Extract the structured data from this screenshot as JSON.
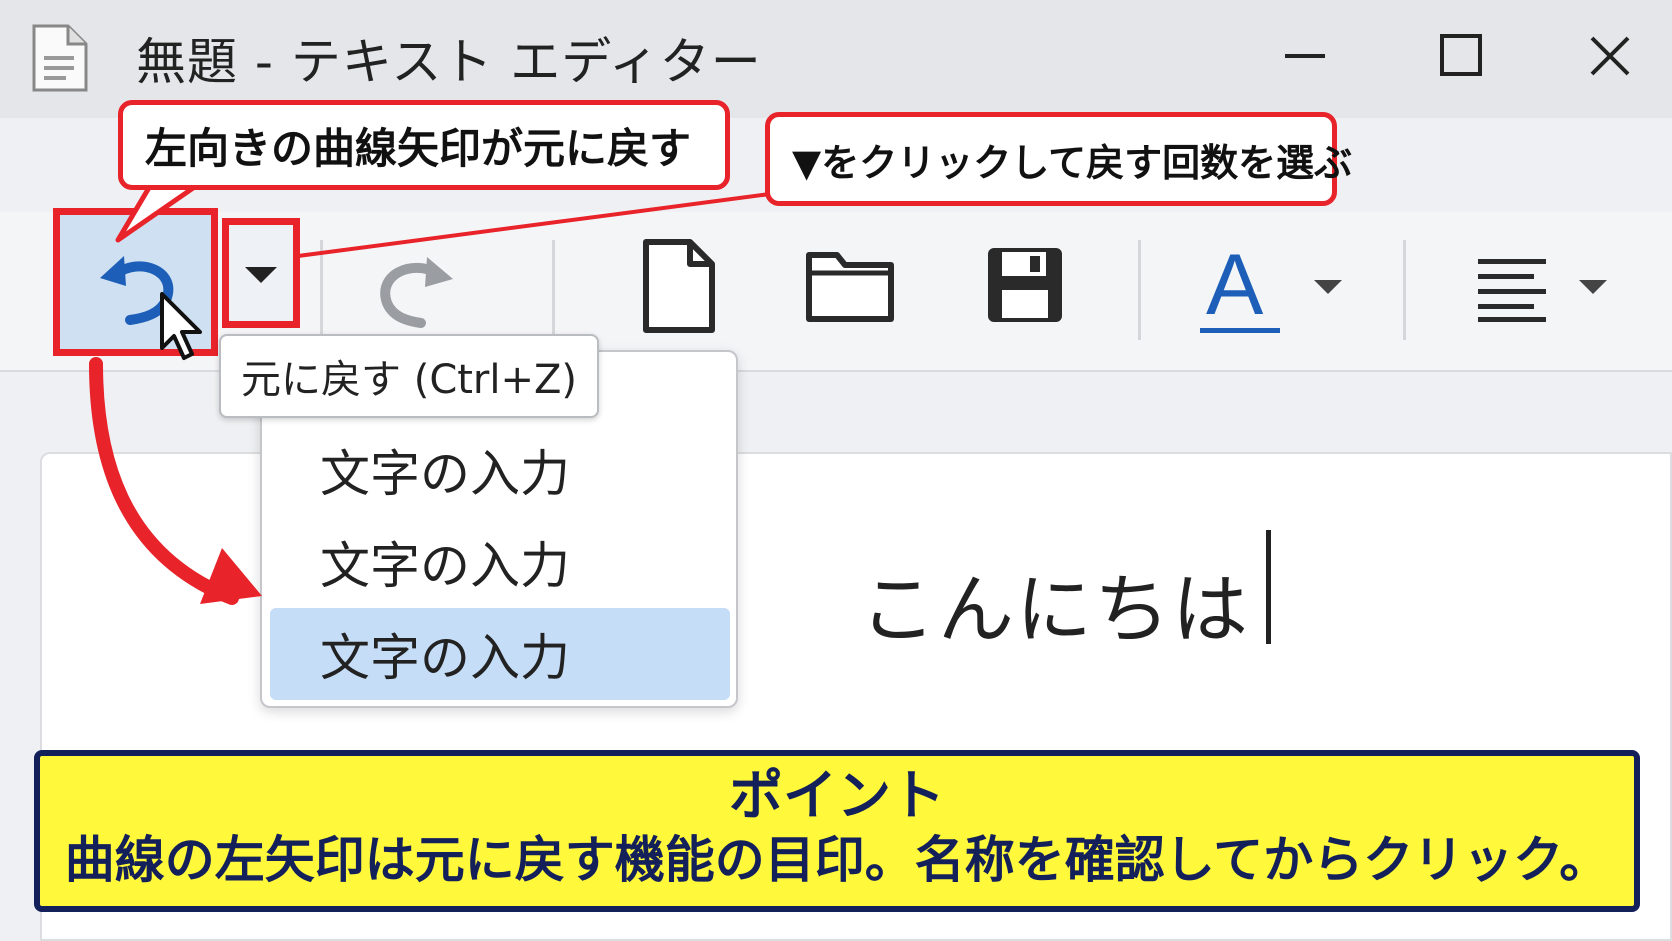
{
  "window": {
    "title": "無題 - テキスト エディター",
    "app_icon": "document-icon",
    "controls": [
      "minimize-icon",
      "maximize-icon",
      "close-icon"
    ]
  },
  "toolbar": {
    "buttons": [
      {
        "name": "undo",
        "icon": "undo-arrow-icon"
      },
      {
        "name": "undo-dropdown",
        "icon": "chevron-down-icon"
      },
      {
        "name": "redo",
        "icon": "redo-arrow-icon"
      },
      {
        "name": "new",
        "icon": "new-document-icon"
      },
      {
        "name": "open",
        "icon": "folder-icon"
      },
      {
        "name": "save",
        "icon": "save-disk-icon"
      },
      {
        "name": "font-color",
        "icon": "font-color-icon",
        "label": "A"
      },
      {
        "name": "align",
        "icon": "align-lines-icon"
      }
    ],
    "font_color_label": "A"
  },
  "tooltip": {
    "text": "元に戻す (Ctrl+Z)"
  },
  "undo_history": {
    "items": [
      "文字の入力",
      "文字の入力",
      "文字の入力"
    ],
    "selected_index": 2
  },
  "document": {
    "text": "こんにちは"
  },
  "callouts": {
    "undo": "左向きの曲線矢印が元に戻す",
    "dropdown": "▼をクリックして戻す回数を選ぶ"
  },
  "point": {
    "title": "ポイント",
    "body": "曲線の左矢印は元に戻す機能の目印。名称を確認してからクリック。"
  },
  "colors": {
    "highlight_red": "#e8232a",
    "selection_blue": "#c5ddf7",
    "undo_blue": "#1d5fb8",
    "point_yellow": "#fff83b",
    "point_navy": "#13205a"
  }
}
